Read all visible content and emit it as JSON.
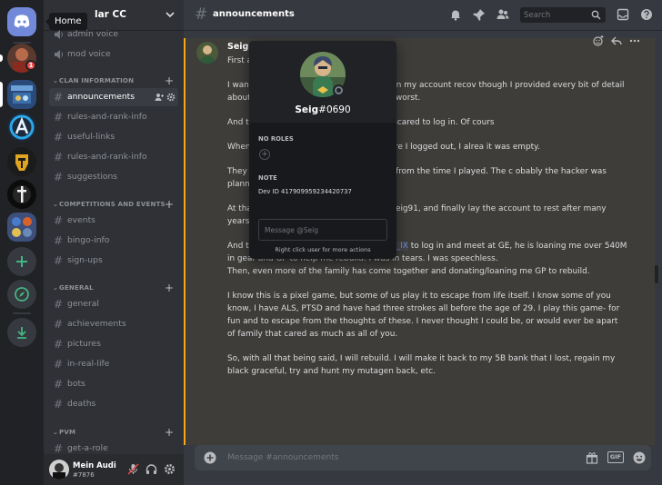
{
  "tooltip": {
    "home": "Home"
  },
  "rail": {
    "badge_count": "1"
  },
  "sidebar": {
    "server_name": "lar CC",
    "voice_channels": [
      {
        "label": "admin voice"
      },
      {
        "label": "mod voice"
      }
    ],
    "categories": [
      {
        "name": "CLAN INFORMATION",
        "channels": [
          {
            "label": "announcements"
          },
          {
            "label": "rules-and-rank-info"
          },
          {
            "label": "useful-links"
          },
          {
            "label": "rules-and-rank-info"
          },
          {
            "label": "suggestions"
          }
        ]
      },
      {
        "name": "COMPETITIONS AND EVENTS",
        "channels": [
          {
            "label": "events"
          },
          {
            "label": "bingo-info"
          },
          {
            "label": "sign-ups"
          }
        ]
      },
      {
        "name": "GENERAL",
        "channels": [
          {
            "label": "general"
          },
          {
            "label": "achievements"
          },
          {
            "label": "pictures"
          },
          {
            "label": "in-real-life"
          },
          {
            "label": "bots"
          },
          {
            "label": "deaths"
          }
        ]
      },
      {
        "name": "PVM",
        "channels": [
          {
            "label": "get-a-role"
          }
        ]
      }
    ]
  },
  "user": {
    "name": "Mein Audi",
    "tag": "#7876"
  },
  "header": {
    "channel_name": "announcements",
    "search_placeholder": "Search"
  },
  "message": {
    "author": "Seig",
    "paragraphs": [
      "First a                              e. This clan is truly a family.",
      "I wan                              hijacked I was devastated. And when my account recov                           though I provided every bit of detail about my account since                          ed.. thinking the worst.",
      "And t                            al attempt recovery request, I was scared to log in. Of cours",
      "When                            ompletely different place then where I logged out, I alrea                            it was empty.",
      "They                            vement I have done on my account from the time I played. The c                           obably the hacker was planning on selling it with the cape to inc",
      "At that point, I was planning on quitting Seig91, and finally lay the account to rest after many years of the accounts life."
    ],
    "mention_intro": "And then, I was messaged by",
    "mention": "@Xi_Marino_IX",
    "mention_rest": "to log in and meet at GE, he is loaning me over 540M in gear and GP to help me rebuild. I was in tears. I was speechless.",
    "mention_line2": "Then, even more of the family has come together and donating/loaning me GP to rebuild.",
    "paragraphs_after": [
      "I know this is a pixel game, but some of us play it to escape from life itself. I know some of you know, I have ALS, PTSD and have had three strokes all before the age of 29. I play this game- for fun and to escape from the thoughts of these. I never thought I could be, or would ever be apart of family that cared as much as all of you.",
      "So, with all that being said, I will rebuild. I will make it back to my 5B bank that I lost, regain my black graceful, try and hunt my mutagen back, etc."
    ]
  },
  "composer": {
    "placeholder": "Message #announcements",
    "gif_label": "GIF"
  },
  "popout": {
    "name": "Seig",
    "discriminator": "#0690",
    "roles_heading": "NO ROLES",
    "note_heading": "NOTE",
    "note": "Dev ID 417909959234420737",
    "message_placeholder": "Message @Seig",
    "hint": "Right click user for more actions"
  },
  "colors": {
    "blurple": "#7289da",
    "rail_bg": "#202225",
    "sidebar_bg": "#2f3136",
    "chat_bg": "#36393f",
    "highlight_border": "#faa61a",
    "green": "#43b581",
    "red": "#f04747"
  },
  "icons": [
    "discord-logo-icon",
    "add-server-icon",
    "explore-icon",
    "download-icon",
    "chevron-down-icon",
    "hash-icon",
    "speaker-icon",
    "add-member-icon",
    "gear-icon",
    "bell-icon",
    "pin-icon",
    "members-icon",
    "search-icon",
    "inbox-icon",
    "help-icon",
    "reaction-icon",
    "reply-icon",
    "more-icon",
    "plus-circle-icon",
    "gift-icon",
    "gif-icon",
    "emoji-icon",
    "mute-mic-icon",
    "headphones-icon"
  ]
}
